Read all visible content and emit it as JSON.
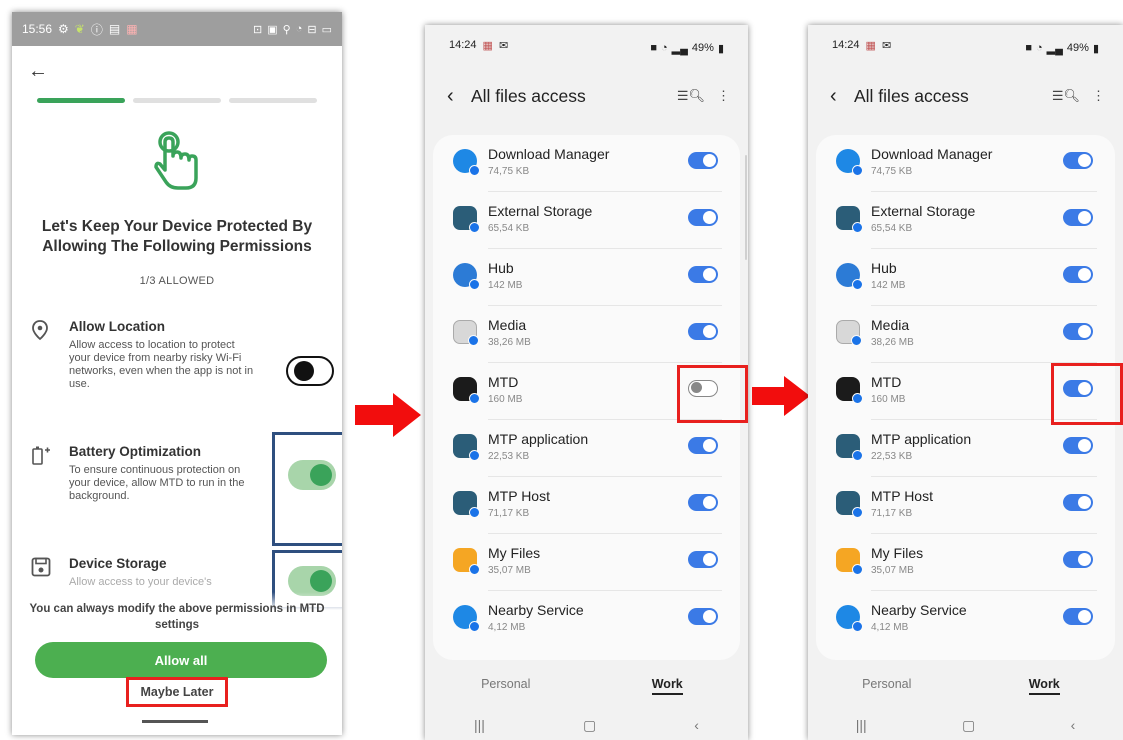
{
  "phone1": {
    "status_time": "15:56",
    "headline": "Let's Keep Your Device Protected By Allowing The Following Permissions",
    "allowed_count": "1/3 ALLOWED",
    "permissions": [
      {
        "title": "Allow Location",
        "desc": "Allow access to location to protect your device from nearby risky Wi-Fi networks, even when the app is not in use.",
        "enabled": false
      },
      {
        "title": "Battery Optimization",
        "desc": "To ensure continuous protection on your device, allow MTD to run in the background.",
        "enabled": true
      },
      {
        "title": "Device Storage",
        "desc": "Allow access to your device's",
        "enabled": true
      }
    ],
    "footnote": "You can always modify the above permissions in MTD settings",
    "allow_all": "Allow all",
    "maybe_later": "Maybe Later",
    "accent": "#4caf50"
  },
  "files_screen": {
    "status_time": "14:24",
    "battery": "49%",
    "title": "All files access",
    "tabs": [
      "Personal",
      "Work"
    ],
    "toggle_on_color": "#3b7ae6",
    "apps": [
      {
        "name": "Download Manager",
        "size": "74,75 KB"
      },
      {
        "name": "External Storage",
        "size": "65,54 KB"
      },
      {
        "name": "Hub",
        "size": "142 MB"
      },
      {
        "name": "Media",
        "size": "38,26 MB"
      },
      {
        "name": "MTD",
        "size": "160 MB"
      },
      {
        "name": "MTP application",
        "size": "22,53 KB"
      },
      {
        "name": "MTP Host",
        "size": "71,17 KB"
      },
      {
        "name": "My Files",
        "size": "35,07 MB"
      },
      {
        "name": "Nearby Service",
        "size": "4,12 MB"
      }
    ],
    "before_mtd_enabled": false,
    "after_mtd_enabled": true
  }
}
